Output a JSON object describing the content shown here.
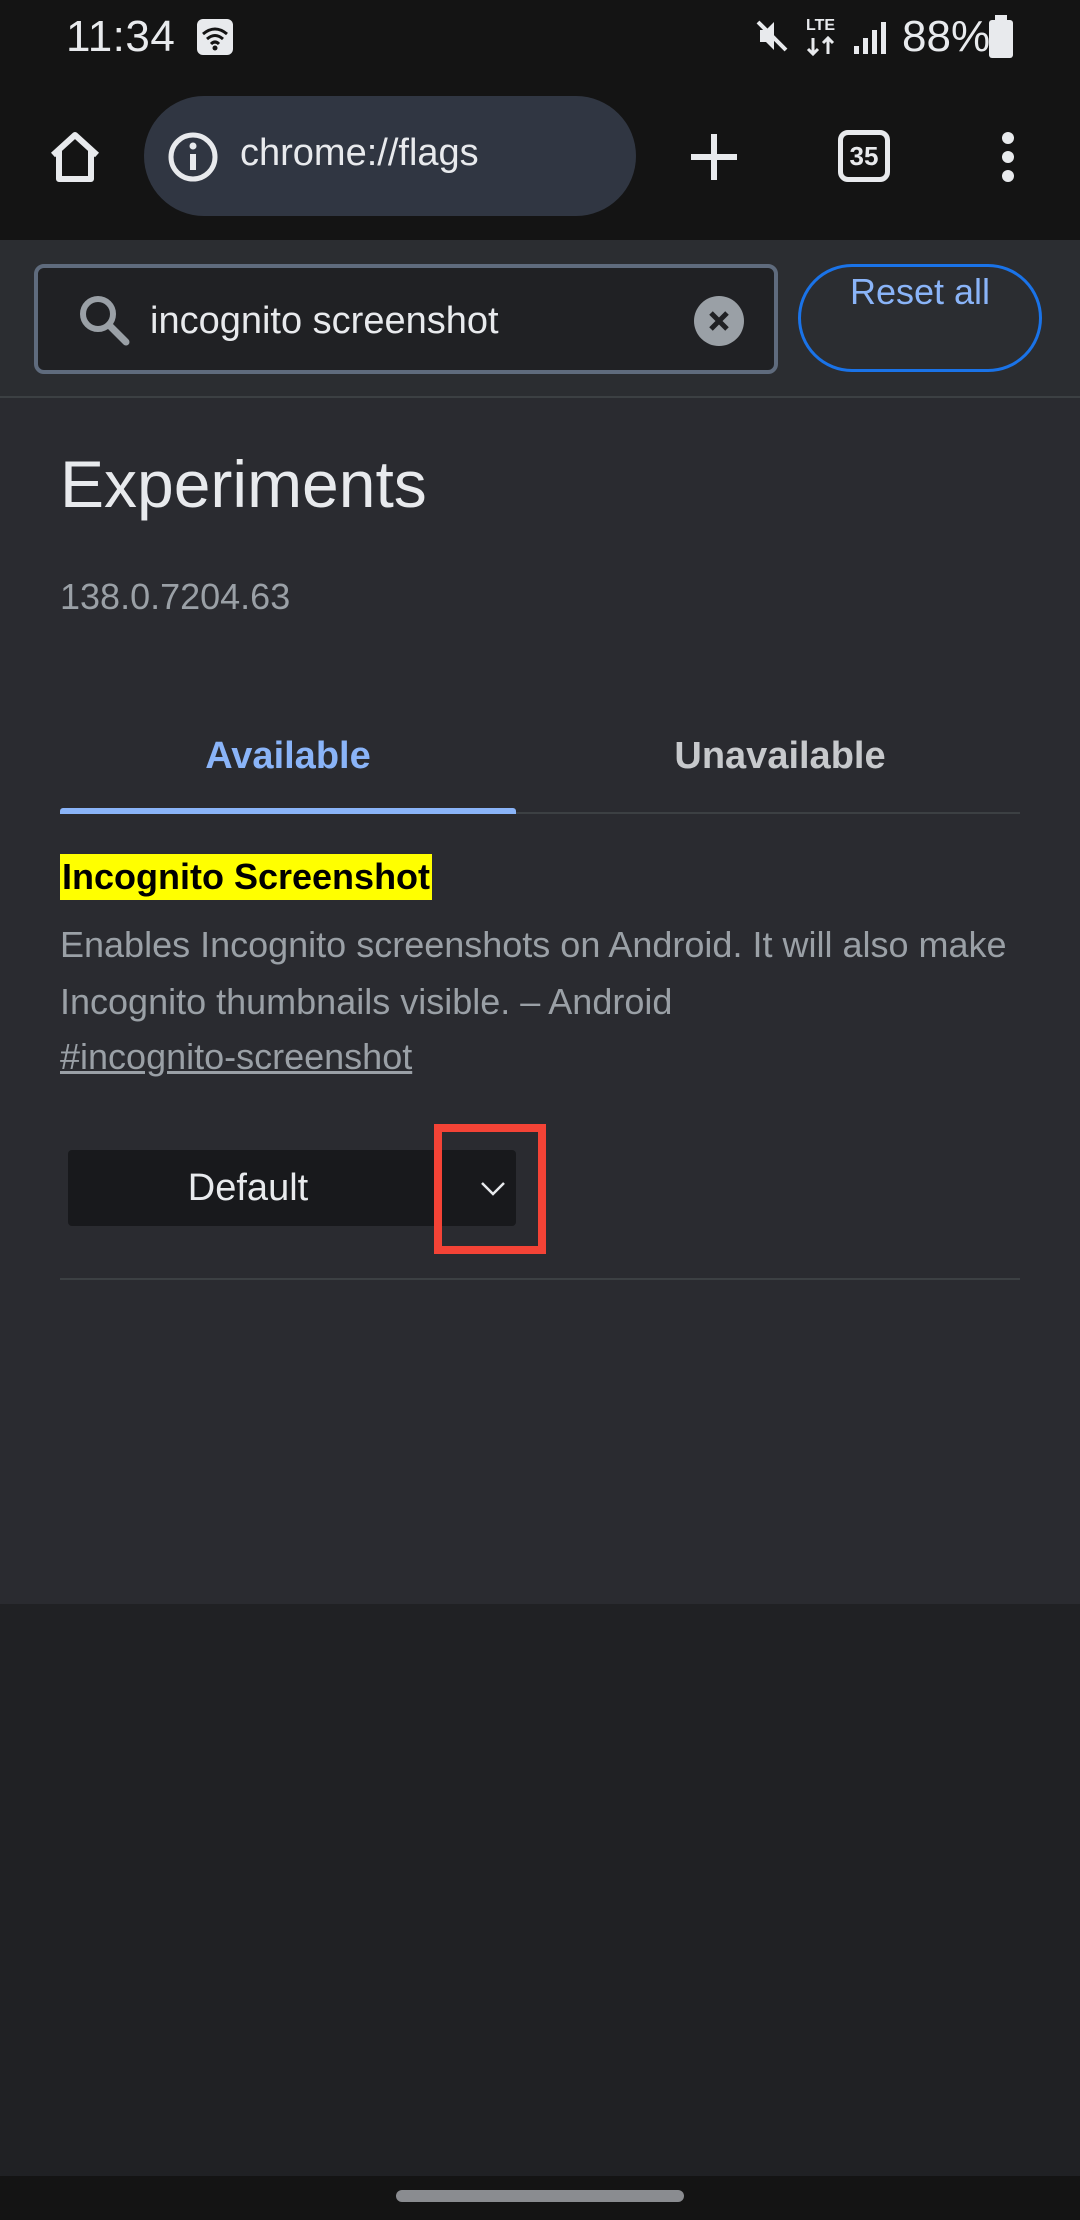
{
  "status_bar": {
    "time": "11:34",
    "battery": "88%",
    "network": "LTE"
  },
  "toolbar": {
    "url": "chrome://flags",
    "tab_count": "35"
  },
  "search": {
    "value": "incognito screenshot",
    "reset_label": "Reset all"
  },
  "page": {
    "title": "Experiments",
    "version": "138.0.7204.63",
    "tabs": [
      {
        "label": "Available",
        "selected": true
      },
      {
        "label": "Unavailable",
        "selected": false
      }
    ]
  },
  "flag": {
    "title": "Incognito Screenshot",
    "description": "Enables Incognito screenshots on Android. It will also make Incognito thumbnails visible. – Android",
    "link": "#incognito-screenshot",
    "selected_option": "Default"
  },
  "colors": {
    "accent": "#8ab4f8",
    "highlight_yellow": "#ffff00",
    "annotation_red": "#f44336"
  }
}
